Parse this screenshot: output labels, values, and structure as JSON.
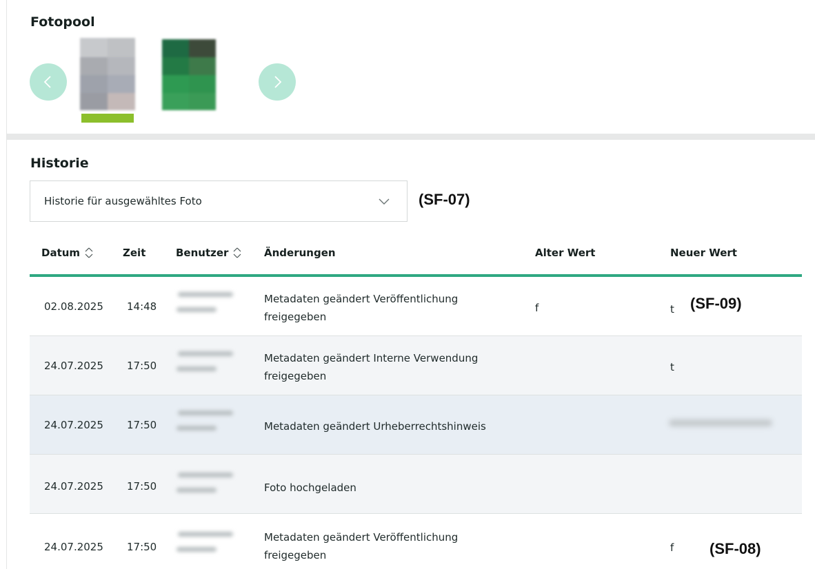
{
  "fotopool": {
    "title": "Fotopool",
    "prev_label": "‹",
    "next_label": "›",
    "accent": "#b6e7d6",
    "selected_indicator_color": "#8cbf2c"
  },
  "historie": {
    "title": "Historie",
    "select_value": "Historie für ausgewähltes Foto",
    "annotation_select": "(SF-07)",
    "columns": {
      "datum": "Datum",
      "zeit": "Zeit",
      "benutzer": "Benutzer",
      "aenderungen": "Änderungen",
      "alter_wert": "Alter Wert",
      "neuer_wert": "Neuer Wert"
    },
    "header_rule_color": "#2fa882",
    "rows": [
      {
        "datum": "02.08.2025",
        "zeit": "14:48",
        "aenderung_1": "Metadaten geändert Veröffentlichung",
        "aenderung_2": "freigegeben",
        "alter_wert": "f",
        "neuer_wert": "t",
        "annotation": "(SF-09)"
      },
      {
        "datum": "24.07.2025",
        "zeit": "17:50",
        "aenderung_1": "Metadaten geändert Interne Verwendung",
        "aenderung_2": "freigegeben",
        "alter_wert": "",
        "neuer_wert": "t",
        "annotation": ""
      },
      {
        "datum": "24.07.2025",
        "zeit": "17:50",
        "aenderung_1": "Metadaten geändert Urheberrechtshinweis",
        "aenderung_2": "",
        "alter_wert": "",
        "neuer_wert": "",
        "annotation": ""
      },
      {
        "datum": "24.07.2025",
        "zeit": "17:50",
        "aenderung_1": "Foto hochgeladen",
        "aenderung_2": "",
        "alter_wert": "",
        "neuer_wert": "",
        "annotation": ""
      },
      {
        "datum": "24.07.2025",
        "zeit": "17:50",
        "aenderung_1": "Metadaten geändert Veröffentlichung",
        "aenderung_2": "freigegeben",
        "alter_wert": "",
        "neuer_wert": "f",
        "annotation": "(SF-08)"
      }
    ]
  }
}
